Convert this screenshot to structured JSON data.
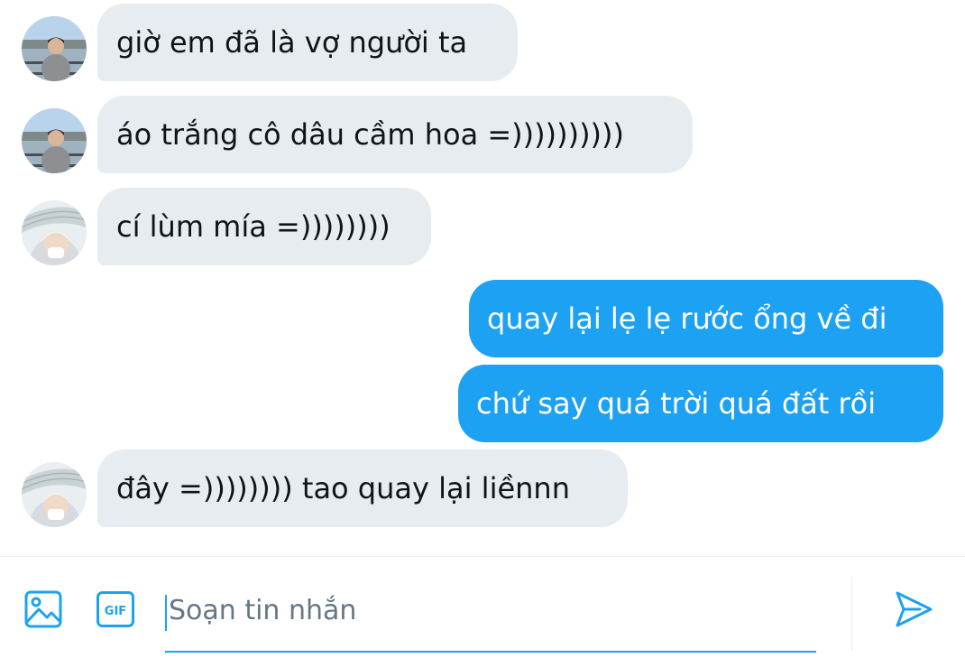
{
  "messages": [
    {
      "direction": "incoming",
      "sender": "friend_a",
      "text": "giờ em đã là vợ người ta"
    },
    {
      "direction": "incoming",
      "sender": "friend_a",
      "text": "áo trắng cô dâu cầm hoa =))))))))))"
    },
    {
      "direction": "incoming",
      "sender": "friend_b",
      "text": "cí lùm mía =))))))))"
    },
    {
      "direction": "outgoing",
      "text": "quay lại lẹ lẹ rước ổng về đi"
    },
    {
      "direction": "outgoing",
      "text": "chứ say quá trời quá đất rồi"
    },
    {
      "direction": "incoming",
      "sender": "friend_b",
      "text": "đây =)))))))) tao quay lại liềnnn"
    }
  ],
  "composer": {
    "placeholder": "Soạn tin nhắn",
    "value": "",
    "gif_label": "GIF",
    "media_icon": "image-icon",
    "send_icon": "send-icon"
  },
  "colors": {
    "accent": "#1da1f2",
    "incoming_bubble": "#e6ecf0",
    "incoming_text": "#0f1419",
    "outgoing_text": "#ffffff",
    "placeholder": "#657786"
  }
}
